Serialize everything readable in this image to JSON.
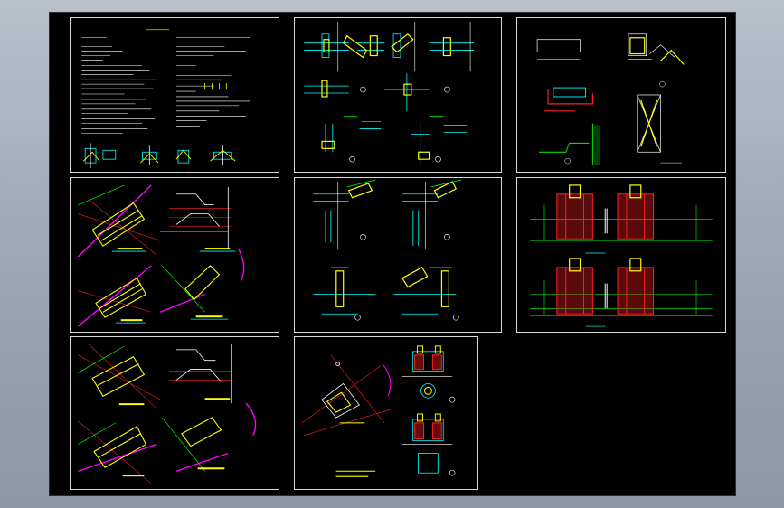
{
  "app": {
    "title": ""
  },
  "viewport": {
    "background": "#000000"
  },
  "sheets": [
    {
      "id": "notes"
    },
    {
      "id": "connections-1"
    },
    {
      "id": "details-a"
    },
    {
      "id": "stair-plan-1"
    },
    {
      "id": "connections-2"
    },
    {
      "id": "foundation-elev"
    },
    {
      "id": "stair-plan-2"
    },
    {
      "id": "site-detail"
    }
  ],
  "colors": {
    "frame": "#d8d8d8",
    "cyan": "#00ffff",
    "yellow": "#ffff00",
    "green": "#00ff00",
    "red": "#ff2020",
    "magenta": "#ff00ff",
    "white": "#ffffff"
  },
  "icons": [
    "section-marker-icon",
    "north-arrow-icon"
  ]
}
